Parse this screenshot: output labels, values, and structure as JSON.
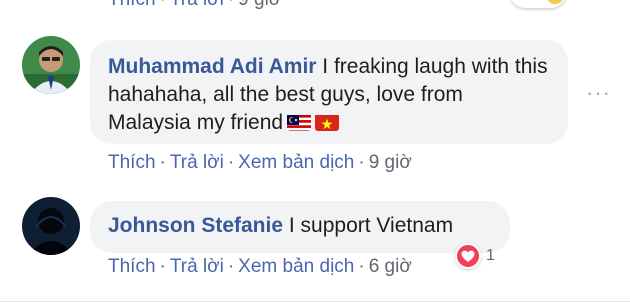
{
  "top_row": {
    "like": "Thích",
    "reply": "Trả lời",
    "time": "9 giờ"
  },
  "comments": [
    {
      "author": "Muhammad Adi Amir",
      "text": " I freaking laugh with this hahahaha, all the best guys, love from Malaysia my friend",
      "flags": [
        "malaysia-flag",
        "vietnam-flag"
      ],
      "actions": {
        "like": "Thích",
        "reply": "Trả lời",
        "translate": "Xem bản dịch",
        "time": "9 giờ"
      }
    },
    {
      "author": "Johnson Stefanie",
      "text": " I support Vietnam",
      "reaction": {
        "icon": "heart-icon",
        "count": "1"
      },
      "actions": {
        "like": "Thích",
        "reply": "Trả lời",
        "translate": "Xem bản dịch",
        "time": "6 giờ"
      }
    }
  ],
  "more_label": "···",
  "colors": {
    "link": "#4a66b0",
    "author": "#385898",
    "bubble": "#f2f3f5",
    "heart": "#f33e58"
  }
}
